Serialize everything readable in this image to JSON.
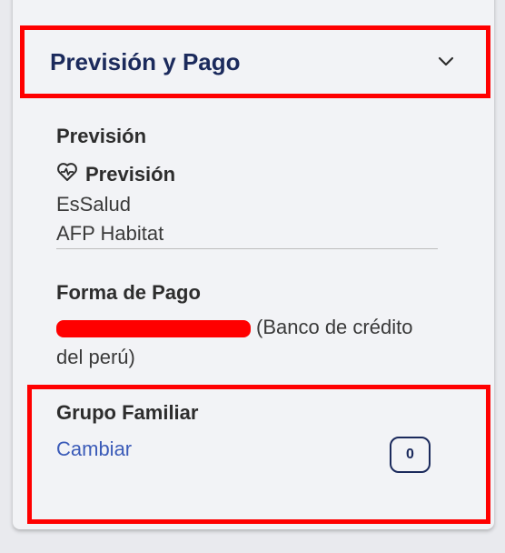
{
  "accordion": {
    "title": "Previsión y Pago",
    "chevron_icon": "chevron-down-icon"
  },
  "prevision": {
    "section_title": "Previsión",
    "sub_title": "Previsión",
    "sub_icon": "heart-pulse-icon",
    "lines": [
      "EsSalud",
      "AFP Habitat"
    ]
  },
  "payment": {
    "section_title": "Forma de Pago",
    "bank_line1": "(Banco de crédito",
    "bank_line2": "del perú)"
  },
  "family": {
    "section_title": "Grupo Familiar",
    "change_link": "Cambiar",
    "count": "0"
  },
  "colors": {
    "highlight": "#ff0000",
    "title_navy": "#1b2a5c",
    "link_blue": "#3b5bb8"
  }
}
